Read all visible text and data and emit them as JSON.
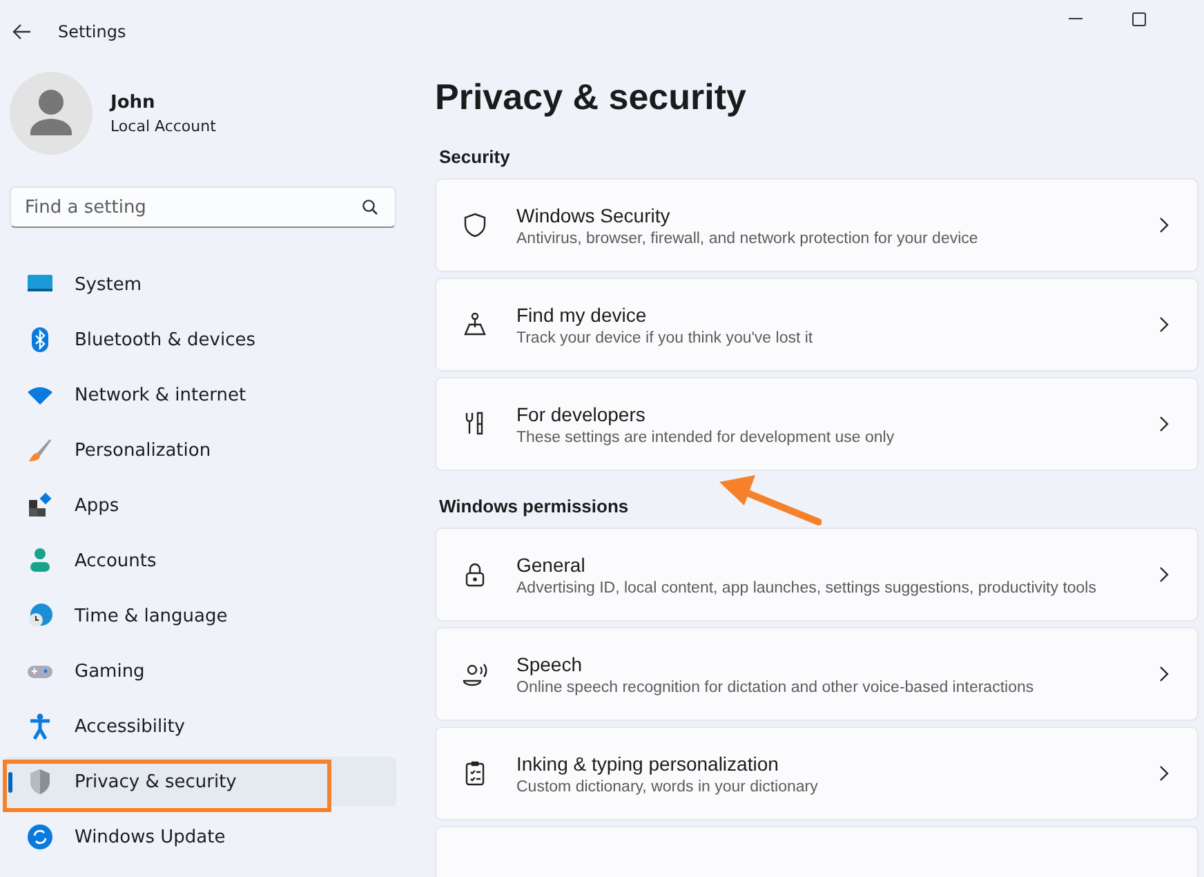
{
  "window": {
    "title": "Settings"
  },
  "profile": {
    "name": "John",
    "account": "Local Account"
  },
  "search": {
    "placeholder": "Find a setting"
  },
  "sidebar": {
    "items": [
      {
        "label": "System",
        "selected": false
      },
      {
        "label": "Bluetooth & devices",
        "selected": false
      },
      {
        "label": "Network & internet",
        "selected": false
      },
      {
        "label": "Personalization",
        "selected": false
      },
      {
        "label": "Apps",
        "selected": false
      },
      {
        "label": "Accounts",
        "selected": false
      },
      {
        "label": "Time & language",
        "selected": false
      },
      {
        "label": "Gaming",
        "selected": false
      },
      {
        "label": "Accessibility",
        "selected": false
      },
      {
        "label": "Privacy & security",
        "selected": true
      },
      {
        "label": "Windows Update",
        "selected": false
      }
    ]
  },
  "page": {
    "title": "Privacy & security"
  },
  "sections": [
    {
      "heading": "Security",
      "cards": [
        {
          "title": "Windows Security",
          "subtitle": "Antivirus, browser, firewall, and network protection for your device"
        },
        {
          "title": "Find my device",
          "subtitle": "Track your device if you think you've lost it"
        },
        {
          "title": "For developers",
          "subtitle": "These settings are intended for development use only"
        }
      ]
    },
    {
      "heading": "Windows permissions",
      "cards": [
        {
          "title": "General",
          "subtitle": "Advertising ID, local content, app launches, settings suggestions, productivity tools"
        },
        {
          "title": "Speech",
          "subtitle": "Online speech recognition for dictation and other voice-based interactions"
        },
        {
          "title": "Inking & typing personalization",
          "subtitle": "Custom dictionary, words in your dictionary"
        }
      ]
    }
  ]
}
